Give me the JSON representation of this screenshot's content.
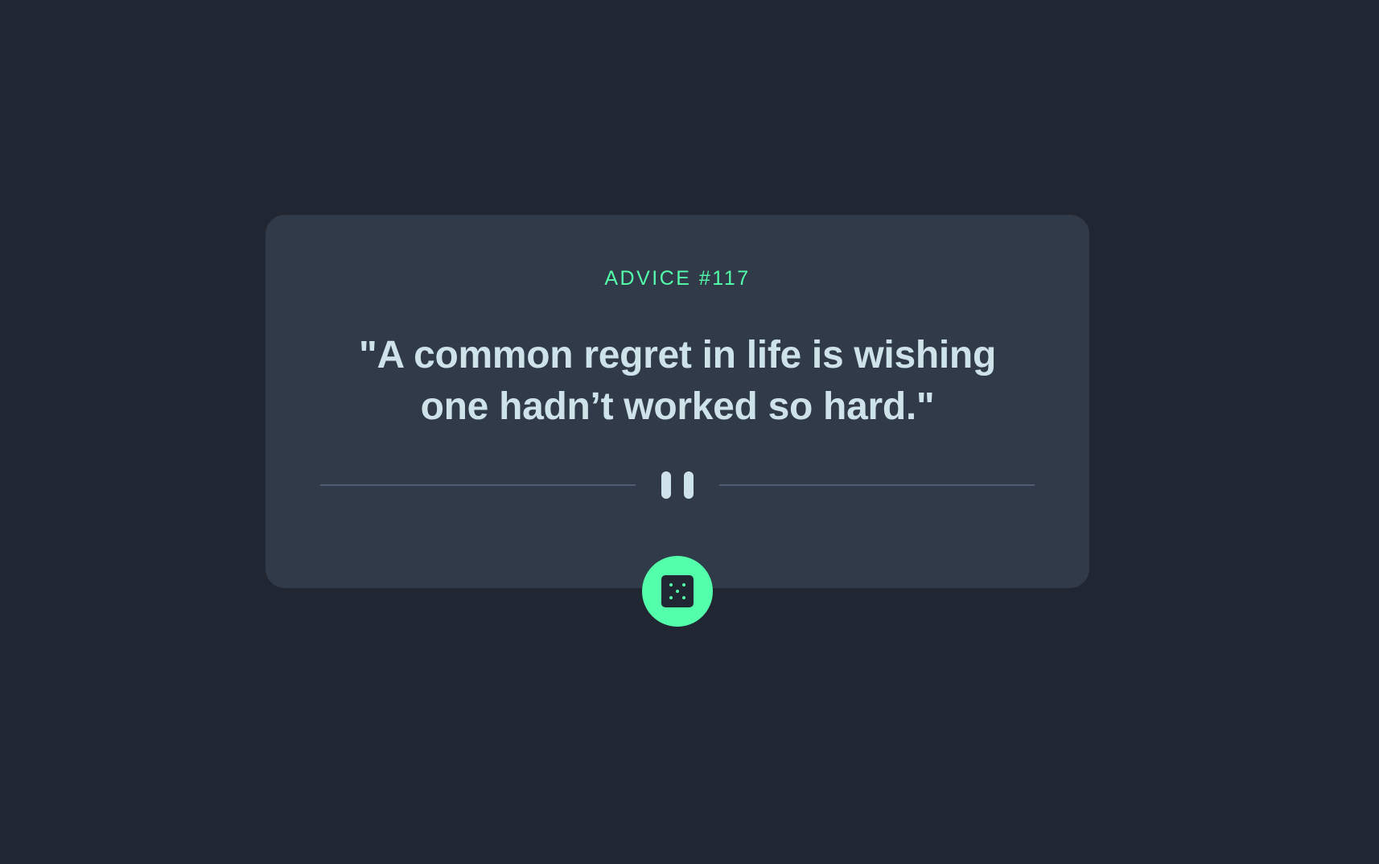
{
  "card": {
    "advice_id": "ADVICE #117",
    "advice_text": "\"A common regret in life is wishing one hadn’t worked so hard.\""
  },
  "divider": {
    "icon": "pause-icon"
  },
  "dice_button": {
    "icon": "dice-icon",
    "accent_color": "#53FFAA"
  },
  "colors": {
    "background": "#202733",
    "card": "#313A48",
    "text": "#CEE3E9",
    "accent": "#53FFAA",
    "divider": "#4F5D74"
  }
}
